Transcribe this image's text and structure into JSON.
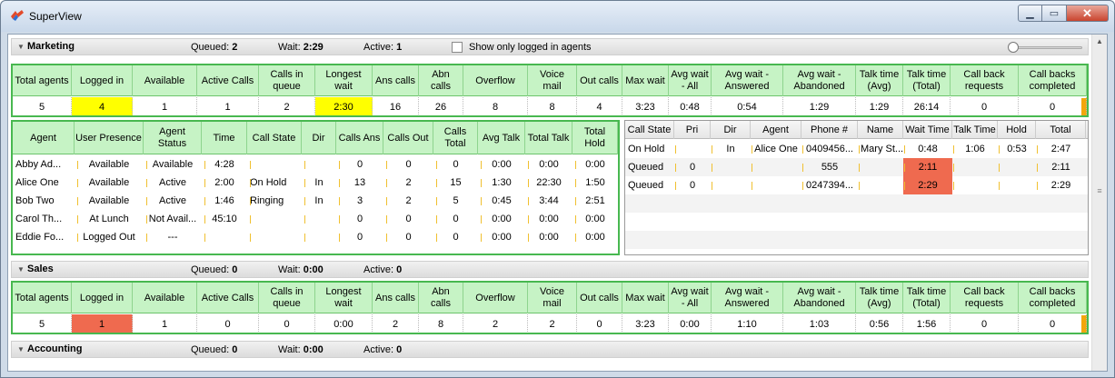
{
  "app": {
    "title": "SuperView"
  },
  "controls": {
    "show_logged_in_label": "Show only logged in agents"
  },
  "summary_headers": [
    "Total agents",
    "Logged in",
    "Available",
    "Active Calls",
    "Calls in queue",
    "Longest wait",
    "Ans calls",
    "Abn calls",
    "Overflow",
    "Voice mail",
    "Out calls",
    "Max wait",
    "Avg wait - All",
    "Avg wait - Answered",
    "Avg wait - Abandoned",
    "Talk time (Avg)",
    "Talk time (Total)",
    "Call back requests",
    "Call backs completed"
  ],
  "groups": [
    {
      "name": "Marketing",
      "queued_label": "Queued:",
      "queued": "2",
      "wait_label": "Wait:",
      "wait": "2:29",
      "active_label": "Active:",
      "active": "1",
      "summary": [
        "5",
        "4",
        "1",
        "1",
        "2",
        "2:30",
        "16",
        "26",
        "8",
        "8",
        "4",
        "3:23",
        "0:48",
        "0:54",
        "1:29",
        "1:29",
        "26:14",
        "0",
        "0"
      ]
    },
    {
      "name": "Sales",
      "queued_label": "Queued:",
      "queued": "0",
      "wait_label": "Wait:",
      "wait": "0:00",
      "active_label": "Active:",
      "active": "0",
      "summary": [
        "5",
        "1",
        "1",
        "0",
        "0",
        "0:00",
        "2",
        "8",
        "2",
        "2",
        "0",
        "3:23",
        "0:00",
        "1:10",
        "1:03",
        "0:56",
        "1:56",
        "0",
        "0"
      ]
    },
    {
      "name": "Accounting",
      "queued_label": "Queued:",
      "queued": "0",
      "wait_label": "Wait:",
      "wait": "0:00",
      "active_label": "Active:",
      "active": "0"
    }
  ],
  "agent_headers": [
    "Agent",
    "User Presence",
    "Agent Status",
    "Time",
    "Call State",
    "Dir",
    "Calls Ans",
    "Calls Out",
    "Calls Total",
    "Avg Talk",
    "Total Talk",
    "Total Hold"
  ],
  "agents": [
    [
      "Abby Ad...",
      "Available",
      "Available",
      "4:28",
      "",
      "",
      "0",
      "0",
      "0",
      "0:00",
      "0:00",
      "0:00"
    ],
    [
      "Alice One",
      "Available",
      "Active",
      "2:00",
      "On Hold",
      "In",
      "13",
      "2",
      "15",
      "1:30",
      "22:30",
      "1:50"
    ],
    [
      "Bob Two",
      "Available",
      "Active",
      "1:46",
      "Ringing",
      "In",
      "3",
      "2",
      "5",
      "0:45",
      "3:44",
      "2:51"
    ],
    [
      "Carol Th...",
      "At Lunch",
      "Not Avail...",
      "45:10",
      "",
      "",
      "0",
      "0",
      "0",
      "0:00",
      "0:00",
      "0:00"
    ],
    [
      "Eddie Fo...",
      "Logged Out",
      "---",
      "",
      "",
      "",
      "0",
      "0",
      "0",
      "0:00",
      "0:00",
      "0:00"
    ]
  ],
  "call_headers": [
    "Call State",
    "Pri",
    "Dir",
    "Agent",
    "Phone #",
    "Name",
    "Wait Time",
    "Talk Time",
    "Hold",
    "Total"
  ],
  "calls": [
    [
      "On Hold",
      "",
      "In",
      "Alice One",
      "0409456...",
      "Mary St...",
      "0:48",
      "1:06",
      "0:53",
      "2:47"
    ],
    [
      "Queued",
      "0",
      "",
      "",
      "555",
      "",
      "2:11",
      "",
      "",
      "2:11"
    ],
    [
      "Queued",
      "0",
      "",
      "",
      "0247394...",
      "",
      "2:29",
      "",
      "",
      "2:29"
    ]
  ],
  "highlight_colors": {
    "yellow": "#ffff00",
    "red": "#ef6a4f",
    "green_header": "#c6f3c5",
    "green_border": "#48b850",
    "orange": "#f3a60c"
  }
}
